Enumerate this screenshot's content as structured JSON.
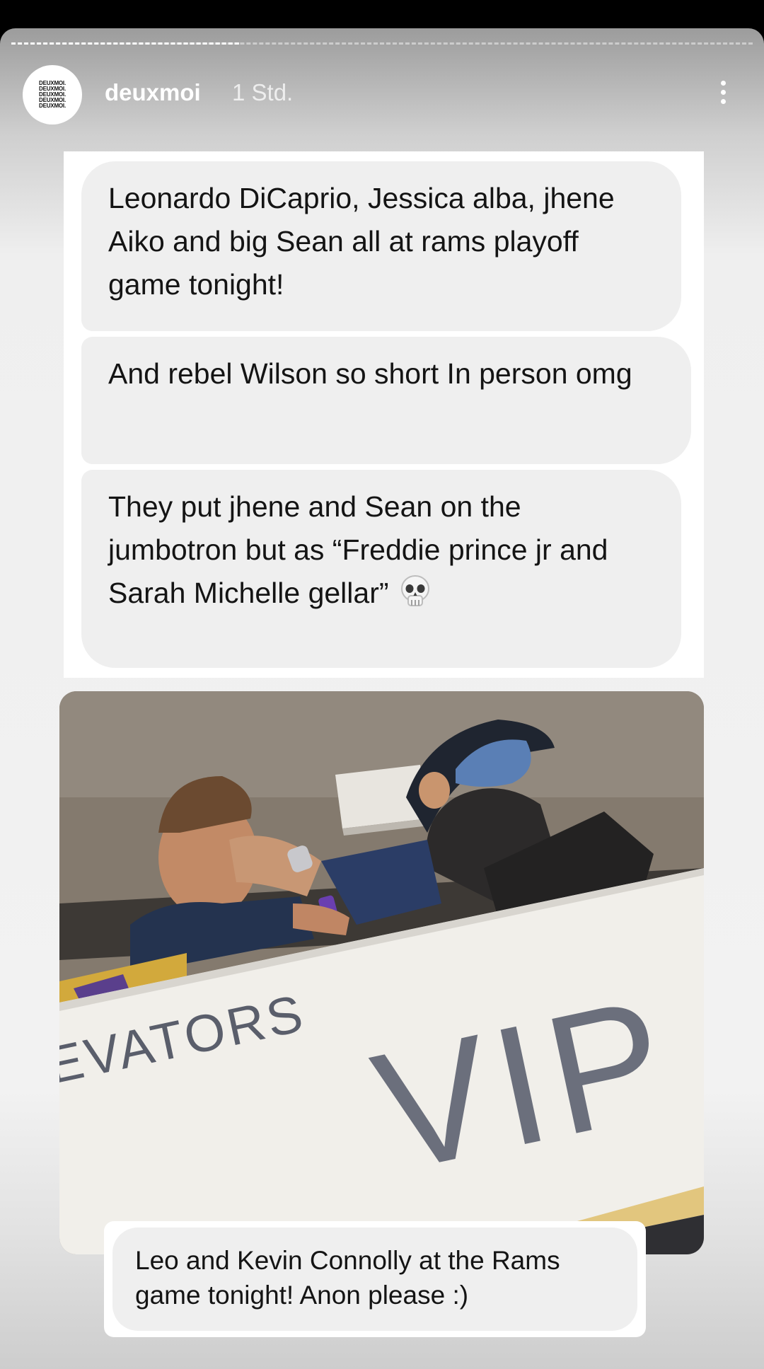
{
  "story": {
    "account": {
      "username": "deuxmoi",
      "time_ago": "1 Std.",
      "avatar_text": [
        "DEUXMOI.",
        "DEUXMOI.",
        "DEUXMOI.",
        "DEUXMOI.",
        "DEUXMOI."
      ]
    },
    "progress": {
      "segments": 4,
      "current_segment": 1
    },
    "messages": [
      {
        "text": "Leonardo DiCaprio, Jessica alba, jhene Aiko and big Sean all at rams playoff game tonight!"
      },
      {
        "text": "And rebel Wilson so short In person omg"
      },
      {
        "text": "They put jhene and Sean on the jumbotron but as “Freddie prince jr and Sarah Michelle gellar”",
        "emoji": "skull-emoji"
      }
    ],
    "photo": {
      "sign_text_left": "EVATORS",
      "sign_text_main": "VIP"
    },
    "caption": {
      "text": "Leo and Kevin Connolly at the Rams game tonight! Anon please :)"
    }
  }
}
